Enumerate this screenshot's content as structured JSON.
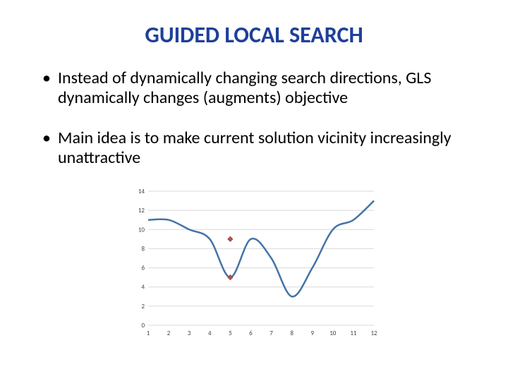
{
  "title": "GUIDED LOCAL SEARCH",
  "bullets": [
    "Instead of dynamically changing search directions, GLS dynamically changes (augments) objective",
    "Main idea is to make current solution vicinity increasingly unattractive"
  ],
  "chart_data": {
    "type": "line",
    "x": [
      1,
      2,
      3,
      4,
      5,
      6,
      7,
      8,
      9,
      10,
      11,
      12
    ],
    "values": [
      11,
      11,
      10,
      9,
      5,
      9,
      7,
      3,
      6,
      10,
      11,
      13
    ],
    "markers": [
      {
        "x": 5,
        "y": 9
      },
      {
        "x": 5,
        "y": 5
      }
    ],
    "ylim": [
      0,
      14
    ],
    "xlim": [
      1,
      12
    ],
    "yticks": [
      0,
      2,
      4,
      6,
      8,
      10,
      12,
      14
    ],
    "xticks": [
      1,
      2,
      3,
      4,
      5,
      6,
      7,
      8,
      9,
      10,
      11,
      12
    ],
    "title": "",
    "xlabel": "",
    "ylabel": ""
  }
}
